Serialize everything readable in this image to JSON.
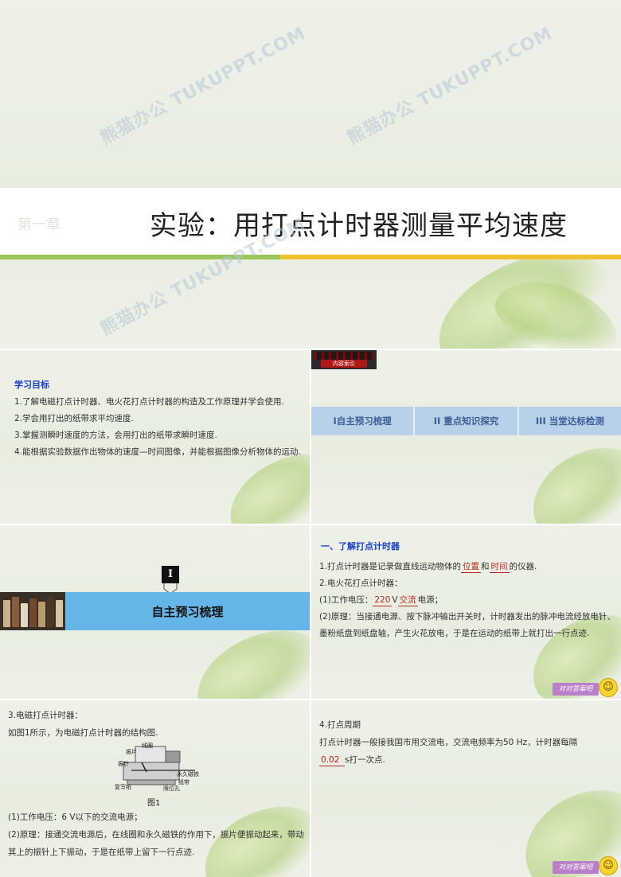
{
  "slide1": {
    "chapter": "第一章",
    "title": "实验：用打点计时器测量平均速度",
    "watermark": "熊猫办公 TUKUPPT.COM"
  },
  "slide2": {
    "heading": "学习目标",
    "items": [
      "1.了解电磁打点计时器、电火花打点计时器的构造及工作原理并学会使用.",
      "2.学会用打出的纸带求平均速度.",
      "3.掌握测瞬时速度的方法，会用打出的纸带求瞬时速度.",
      "4.能根据实验数据作出物体的速度—时间图像，并能根据图像分析物体的运动."
    ]
  },
  "slide3": {
    "badge_label": "内容索引",
    "tabs": [
      "I自主预习梳理",
      "II 重点知识探究",
      "III 当堂达标检测"
    ]
  },
  "slide4": {
    "icon_glyph": "I",
    "section_title": "自主预习梳理"
  },
  "slide5": {
    "heading": "一、了解打点计时器",
    "line1_pre": "1.打点计时器是记录做直线运动物体的",
    "blank1": "位置",
    "line1_mid": "和",
    "blank2": "时间",
    "line1_post": "的仪器.",
    "line2": "2.电火花打点计时器：",
    "line3_pre": "(1)工作电压：",
    "blank3": "220",
    "line3_mid": "V",
    "blank4": "交流",
    "line3_post": "电源；",
    "line4": "(2)原理：当接通电源、按下脉冲输出开关时，计时器发出的脉冲电流经放电针、墨粉纸盘到纸盘轴，产生火花放电，于是在运动的纸带上就打出一行点迹.",
    "answer_button": "对对答案吧"
  },
  "slide6": {
    "line1": "3.电磁打点计时器：",
    "line2": "如图1所示，为电磁打点计时器的结构图.",
    "fig_labels": {
      "a": "线圈",
      "b": "振片",
      "c": "振针",
      "d": "永久磁铁",
      "e": "纸带",
      "f": "复写纸",
      "g": "限位孔"
    },
    "fig_caption": "图1",
    "line3": "(1)工作电压：6 V以下的交流电源；",
    "line4": "(2)原理：接通交流电源后，在线圈和永久磁铁的作用下，振片便振动起来，带动其上的振针上下振动，于是在纸带上留下一行点迹."
  },
  "slide7": {
    "line1": "4.打点周期",
    "line2": "打点计时器一般接我国市用交流电，交流电频率为50 Hz，计时器每隔",
    "blank": "0.02",
    "line3": "s打一次点.",
    "answer_button": "对对答案吧"
  }
}
